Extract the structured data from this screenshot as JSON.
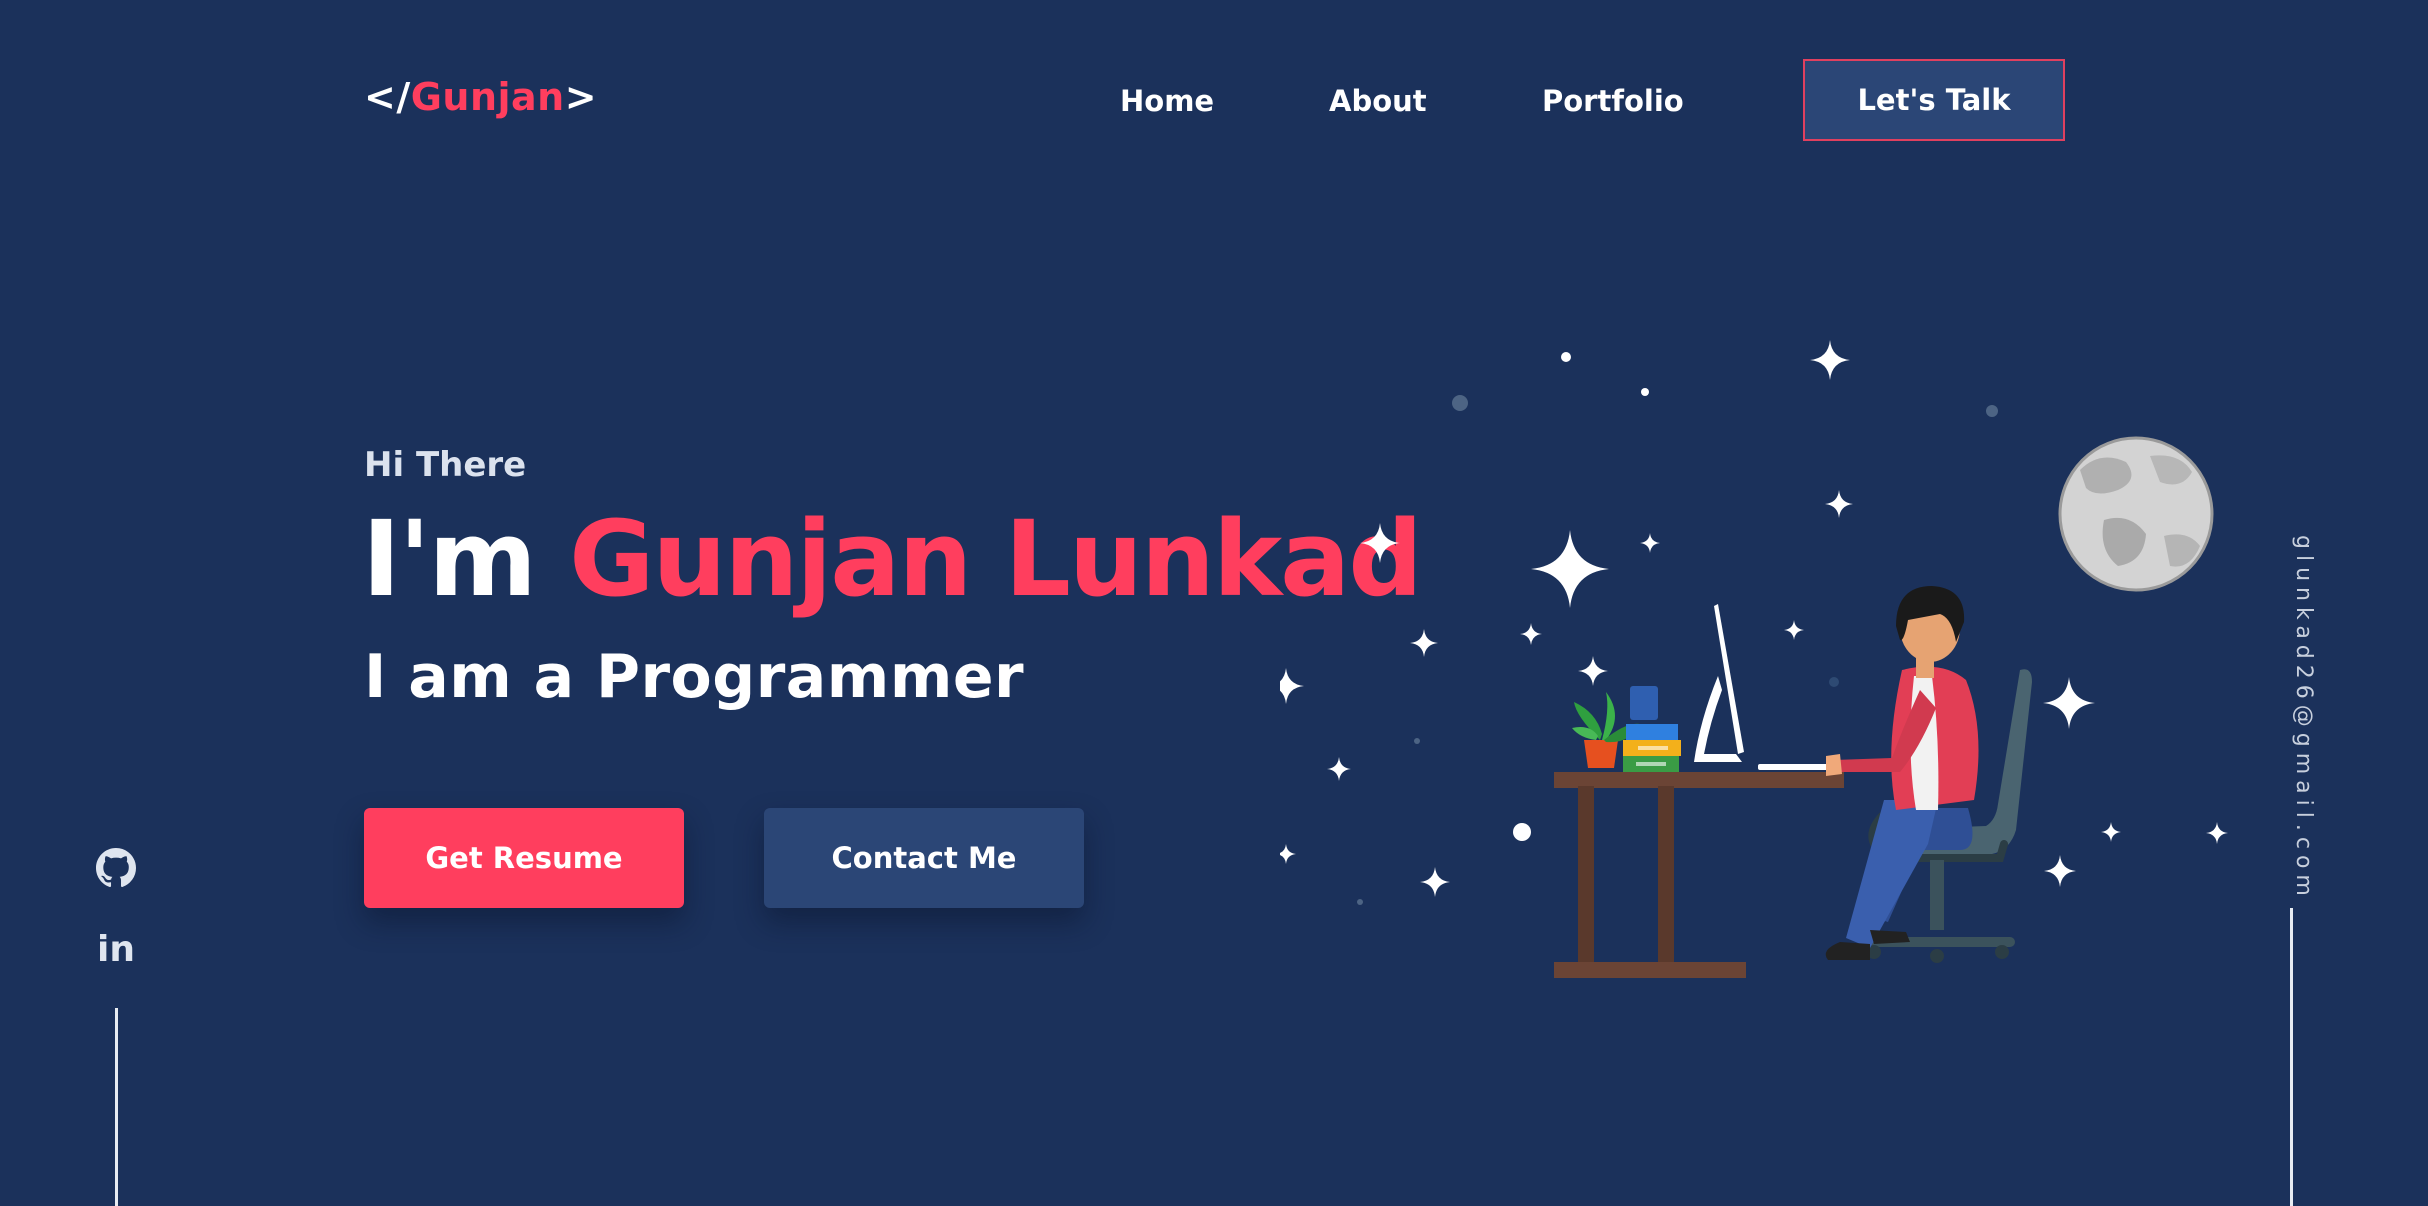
{
  "header": {
    "logo_open": "</",
    "logo_name": "Gunjan",
    "logo_close": ">",
    "nav": [
      {
        "label": "Home"
      },
      {
        "label": "About"
      },
      {
        "label": "Portfolio"
      }
    ],
    "cta_label": "Let's Talk"
  },
  "hero": {
    "greeting": "Hi There",
    "intro": "I'm ",
    "name": "Gunjan Lunkad",
    "role": "I am a  Programmer",
    "primary_button": "Get Resume",
    "secondary_button": "Contact Me"
  },
  "social": [
    {
      "icon": "github-icon"
    },
    {
      "icon": "linkedin-icon",
      "glyph": "in"
    }
  ],
  "sidebar_email": "glunkad26@gmail.com",
  "colors": {
    "background": "#1b315b",
    "accent": "#ff3e5e",
    "button_secondary": "#2b4676"
  }
}
